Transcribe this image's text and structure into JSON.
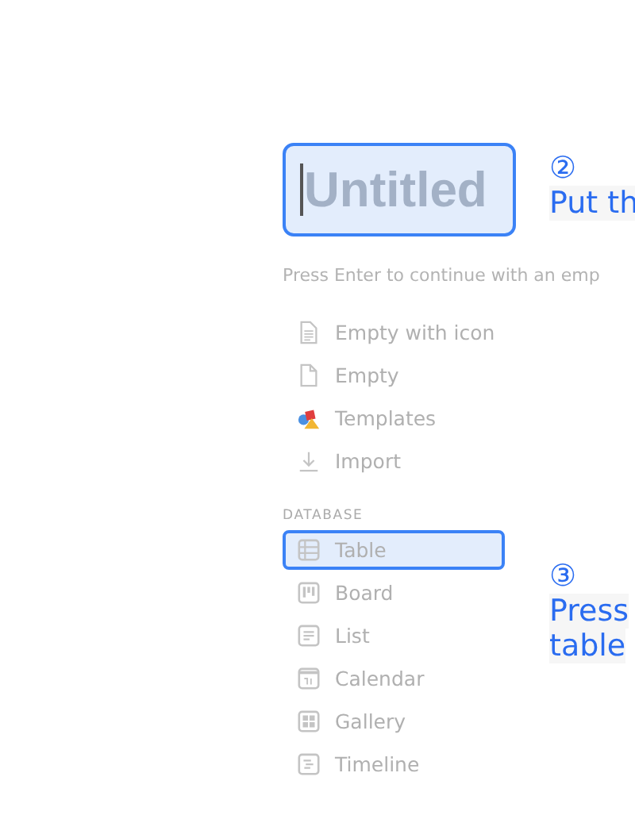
{
  "title_field": {
    "placeholder": "Untitled"
  },
  "hint": "Press Enter to continue with an emp",
  "page_options": [
    {
      "label": "Empty with icon",
      "kind": "doc-lines"
    },
    {
      "label": "Empty",
      "kind": "doc"
    },
    {
      "label": "Templates",
      "kind": "shapes"
    },
    {
      "label": "Import",
      "kind": "download"
    }
  ],
  "database": {
    "heading": "DATABASE",
    "items": [
      {
        "label": "Table",
        "kind": "table",
        "selected": true
      },
      {
        "label": "Board",
        "kind": "board",
        "selected": false
      },
      {
        "label": "List",
        "kind": "list",
        "selected": false
      },
      {
        "label": "Calendar",
        "kind": "calendar",
        "selected": false
      },
      {
        "label": "Gallery",
        "kind": "gallery",
        "selected": false
      },
      {
        "label": "Timeline",
        "kind": "timeline",
        "selected": false
      }
    ]
  },
  "annotations": [
    {
      "number": "②",
      "lines": [
        "Put th"
      ]
    },
    {
      "number": "③",
      "lines": [
        "Press",
        "table"
      ]
    }
  ]
}
